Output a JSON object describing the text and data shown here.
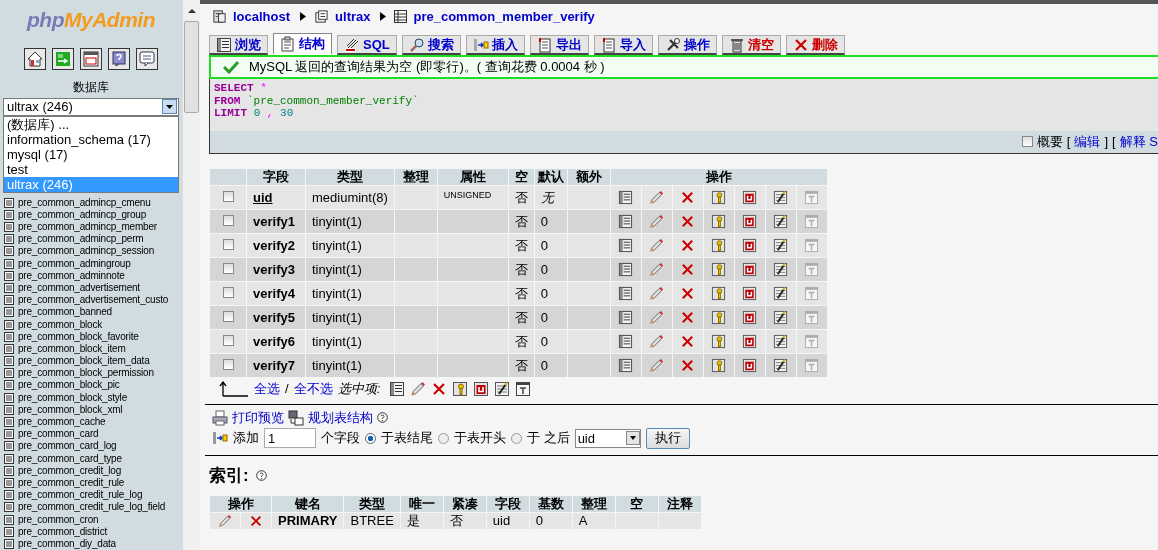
{
  "sidebar": {
    "logo": {
      "php": "php",
      "myadmin": "MyAdmin"
    },
    "db_label": "数据库",
    "db_select": {
      "value": "ultrax (246)",
      "expanded": true,
      "options": [
        {
          "label": "(数据库) ...",
          "selected": false
        },
        {
          "label": "information_schema (17)",
          "selected": false
        },
        {
          "label": "mysql (17)",
          "selected": false
        },
        {
          "label": "test",
          "selected": false
        },
        {
          "label": "ultrax (246)",
          "selected": true
        }
      ]
    },
    "tables": [
      "pre_common_admincp_cmenu",
      "pre_common_admincp_group",
      "pre_common_admincp_member",
      "pre_common_admincp_perm",
      "pre_common_admincp_session",
      "pre_common_admingroup",
      "pre_common_adminnote",
      "pre_common_advertisement",
      "pre_common_advertisement_custo",
      "pre_common_banned",
      "pre_common_block",
      "pre_common_block_favorite",
      "pre_common_block_item",
      "pre_common_block_item_data",
      "pre_common_block_permission",
      "pre_common_block_pic",
      "pre_common_block_style",
      "pre_common_block_xml",
      "pre_common_cache",
      "pre_common_card",
      "pre_common_card_log",
      "pre_common_card_type",
      "pre_common_credit_log",
      "pre_common_credit_rule",
      "pre_common_credit_rule_log",
      "pre_common_credit_rule_log_field",
      "pre_common_cron",
      "pre_common_district",
      "pre_common_diy_data"
    ]
  },
  "breadcrumb": [
    {
      "kind": "server",
      "label": "localhost"
    },
    {
      "kind": "database",
      "label": "ultrax"
    },
    {
      "kind": "table",
      "label": "pre_common_member_verify"
    }
  ],
  "tabs": [
    {
      "kind": "browse",
      "label": "浏览",
      "selected": false,
      "color": "#0000cc"
    },
    {
      "kind": "structure",
      "label": "结构",
      "selected": true,
      "color": "#0000cc"
    },
    {
      "kind": "sql",
      "label": "SQL",
      "selected": false,
      "color": "#0000cc"
    },
    {
      "kind": "search",
      "label": "搜索",
      "selected": false,
      "color": "#0000cc"
    },
    {
      "kind": "insert",
      "label": "插入",
      "selected": false,
      "color": "#0000cc"
    },
    {
      "kind": "export",
      "label": "导出",
      "selected": false,
      "color": "#0000cc"
    },
    {
      "kind": "import",
      "label": "导入",
      "selected": false,
      "color": "#0000cc"
    },
    {
      "kind": "operations",
      "label": "操作",
      "selected": false,
      "color": "#0000cc"
    },
    {
      "kind": "empty",
      "label": "清空",
      "selected": false,
      "color": "#cc0000"
    },
    {
      "kind": "drop",
      "label": "删除",
      "selected": false,
      "color": "#cc0000"
    }
  ],
  "message": {
    "kind": "success",
    "text": "MySQL 返回的查询结果为空 (即零行)。( 查询花费 0.0004 秒 )"
  },
  "sql": {
    "lines": [
      [
        {
          "kind": "keyword",
          "text": "SELECT"
        },
        {
          "kind": "operator",
          "text": "*"
        }
      ],
      [
        {
          "kind": "keyword",
          "text": "FROM"
        },
        {
          "kind": "string",
          "text": "`pre_common_member_verify`"
        }
      ],
      [
        {
          "kind": "keyword",
          "text": "LIMIT"
        },
        {
          "kind": "number",
          "text": "0"
        },
        {
          "kind": "operator",
          "text": ","
        },
        {
          "kind": "number",
          "text": "30"
        }
      ]
    ]
  },
  "sql_options": {
    "profiling": {
      "label": "概要",
      "checked": false
    },
    "links": [
      {
        "open": "[",
        "label": "编辑",
        "close": "]"
      },
      {
        "open": "[",
        "label": "解释 S"
      }
    ]
  },
  "fields_table": {
    "columns": [
      "字段",
      "类型",
      "整理",
      "属性",
      "空",
      "默认",
      "额外"
    ],
    "actions_header": "操作",
    "rows": [
      {
        "selected": false,
        "name": "uid",
        "primary": true,
        "type": "mediumint(8)",
        "attributes": "UNSIGNED",
        "null": "否",
        "default": "无",
        "default_null": true,
        "fulltext_available": false
      },
      {
        "selected": false,
        "name": "verify1",
        "primary": false,
        "type": "tinyint(1)",
        "null": "否",
        "default": "0",
        "default_null": false,
        "fulltext_available": false
      },
      {
        "selected": false,
        "name": "verify2",
        "primary": false,
        "type": "tinyint(1)",
        "null": "否",
        "default": "0",
        "default_null": false,
        "fulltext_available": false
      },
      {
        "selected": false,
        "name": "verify3",
        "primary": false,
        "type": "tinyint(1)",
        "null": "否",
        "default": "0",
        "default_null": false,
        "fulltext_available": false
      },
      {
        "selected": false,
        "name": "verify4",
        "primary": false,
        "type": "tinyint(1)",
        "null": "否",
        "default": "0",
        "default_null": false,
        "fulltext_available": false
      },
      {
        "selected": false,
        "name": "verify5",
        "primary": false,
        "type": "tinyint(1)",
        "null": "否",
        "default": "0",
        "default_null": false,
        "fulltext_available": false
      },
      {
        "selected": false,
        "name": "verify6",
        "primary": false,
        "type": "tinyint(1)",
        "null": "否",
        "default": "0",
        "default_null": false,
        "fulltext_available": false
      },
      {
        "selected": false,
        "name": "verify7",
        "primary": false,
        "type": "tinyint(1)",
        "null": "否",
        "default": "0",
        "default_null": false,
        "fulltext_available": false
      }
    ]
  },
  "bulk": {
    "check_all": "全选",
    "separator": "/",
    "uncheck_all": "全不选",
    "with_selected": "选中项:"
  },
  "links": [
    {
      "kind": "print",
      "label": "打印预览"
    },
    {
      "kind": "relation",
      "label": "规划表结构"
    }
  ],
  "add_field": {
    "label": "添加",
    "count": "1",
    "unit": "个字段",
    "positions": [
      {
        "label": "于表结尾",
        "selected": true
      },
      {
        "label": "于表开头",
        "selected": false
      },
      {
        "label": "于 之后",
        "selected": false
      }
    ],
    "after_field": "uid",
    "button": "执行"
  },
  "indexes": {
    "title": "索引:",
    "columns": [
      "操作",
      "键名",
      "类型",
      "唯一",
      "紧凑",
      "字段",
      "基数",
      "整理",
      "空",
      "注释"
    ],
    "rows": [
      {
        "name": "PRIMARY",
        "type": "BTREE",
        "unique": "是",
        "packed": "否",
        "field": "uid",
        "cardinality": "0",
        "collation": "A"
      }
    ]
  }
}
